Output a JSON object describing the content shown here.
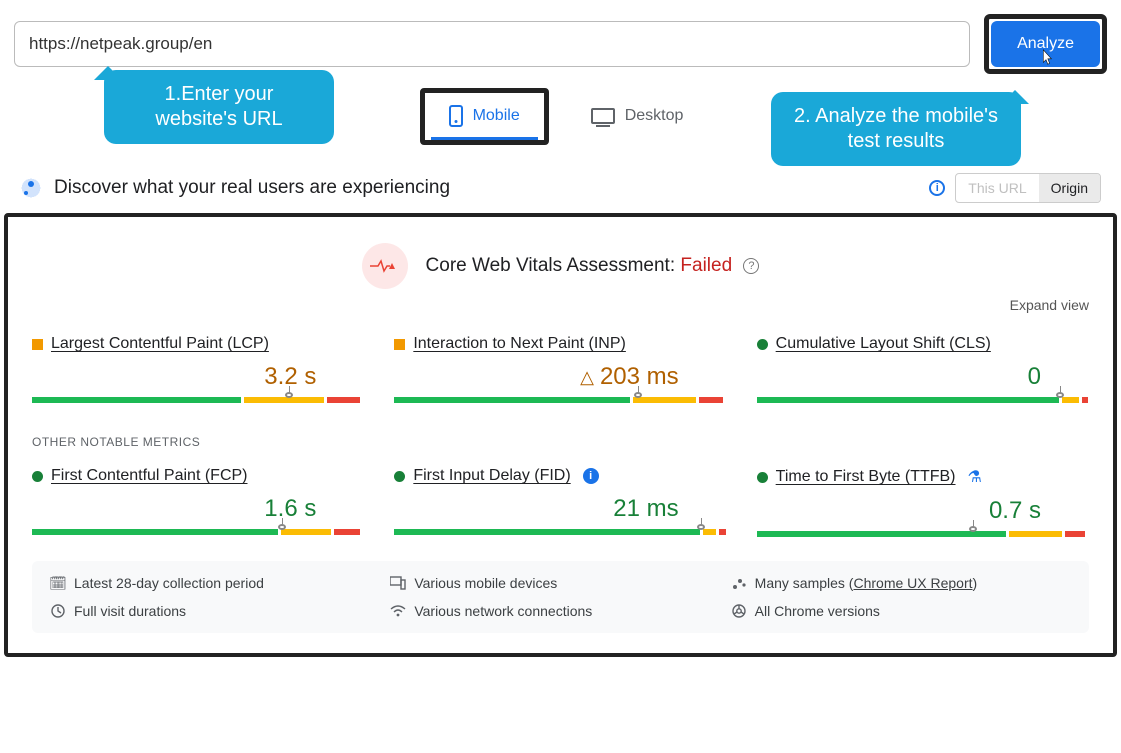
{
  "topbar": {
    "url": "https://netpeak.group/en",
    "analyze": "Analyze"
  },
  "callouts": {
    "c1": "1.Enter your website's URL",
    "c2": "2. Analyze the mobile's test results"
  },
  "tabs": {
    "mobile": "Mobile",
    "desktop": "Desktop"
  },
  "discover": {
    "title": "Discover what your real users are experiencing",
    "scope_inactive": "This URL",
    "scope_active": "Origin"
  },
  "assessment": {
    "label": "Core Web Vitals Assessment: ",
    "status": "Failed"
  },
  "expand": "Expand view",
  "metrics": {
    "lcp": {
      "name": "Largest Contentful Paint (LCP)",
      "value": "3.2 s"
    },
    "inp": {
      "name": "Interaction to Next Paint (INP)",
      "value": "203 ms"
    },
    "cls": {
      "name": "Cumulative Layout Shift (CLS)",
      "value": "0"
    },
    "section": "OTHER NOTABLE METRICS",
    "fcp": {
      "name": "First Contentful Paint (FCP)",
      "value": "1.6 s"
    },
    "fid": {
      "name": "First Input Delay (FID)",
      "value": "21 ms"
    },
    "ttfb": {
      "name": "Time to First Byte (TTFB)",
      "value": "0.7 s"
    }
  },
  "footer": {
    "period": "Latest 28-day collection period",
    "devices": "Various mobile devices",
    "samples_pre": "Many samples (",
    "samples_link": "Chrome UX Report",
    "samples_post": ")",
    "durations": "Full visit durations",
    "network": "Various network connections",
    "versions": "All Chrome versions"
  }
}
